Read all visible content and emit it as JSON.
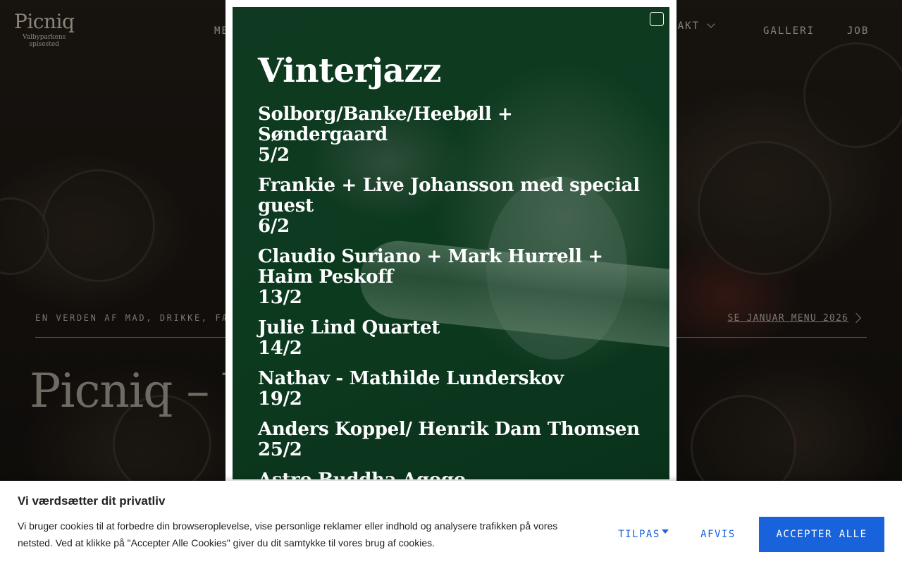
{
  "site": {
    "logo_name": "Picniq",
    "logo_tagline": "Valbyparkens spisested"
  },
  "nav": {
    "items": [
      "MENU",
      "KONTAKT",
      "GALLERI",
      "JOB"
    ]
  },
  "hero": {
    "tagline": "EN VERDEN AF MAD, DRIKKE, FÆ",
    "menu_link": "SE JANUAR MENU 2026",
    "title": "Picniq – V"
  },
  "popup": {
    "title": "Vinterjazz",
    "events": [
      {
        "name": "Solborg/Banke/Heebøll + Søndergaard",
        "date": "5/2"
      },
      {
        "name": "Frankie + Live Johansson med special guest",
        "date": "6/2"
      },
      {
        "name": "Claudio Suriano + Mark Hurrell + Haim Peskoff",
        "date": "13/2"
      },
      {
        "name": "Julie Lind Quartet",
        "date": "14/2"
      },
      {
        "name": "Nathav - Mathilde Lunderskov",
        "date": "19/2"
      },
      {
        "name": "Anders Koppel/ Henrik Dam Thomsen",
        "date": "25/2"
      },
      {
        "name": "Astro Buddha Agogo",
        "date": ""
      }
    ]
  },
  "cookie": {
    "title": "Vi værdsætter dit privatliv",
    "text": "Vi bruger cookies til at forbedre din browseroplevelse, vise personlige reklamer eller indhold og analysere trafikken på vores netsted. Ved at klikke på \"Accepter Alle Cookies\" giver du dit samtykke til vores brug af cookies.",
    "customize_label": "TILPAS",
    "reject_label": "AFVIS",
    "accept_label": "ACCEPTER ALLE",
    "accent_color": "#1863dc"
  }
}
